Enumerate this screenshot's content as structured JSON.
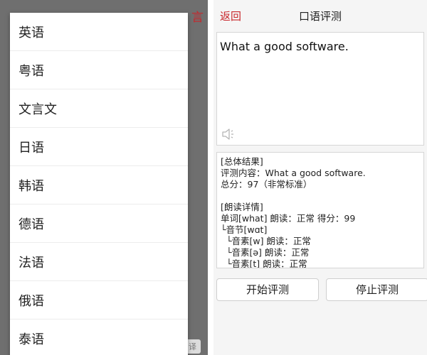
{
  "left": {
    "bg_title_fragment": "言",
    "bg_bottom_fragment": "译",
    "languages": [
      {
        "label": "英语"
      },
      {
        "label": "粤语"
      },
      {
        "label": "文言文"
      },
      {
        "label": "日语"
      },
      {
        "label": "韩语"
      },
      {
        "label": "德语"
      },
      {
        "label": "法语"
      },
      {
        "label": "俄语"
      },
      {
        "label": "泰语"
      }
    ]
  },
  "right": {
    "header": {
      "back_label": "返回",
      "title": "口语评测"
    },
    "input": {
      "text": "What a good software.",
      "speaker_icon": "speaker-icon"
    },
    "result": {
      "lines": [
        "[总体结果]",
        "评测内容：What a good software.",
        "总分：97（非常标准）",
        "",
        "[朗读详情]",
        "单词[what] 朗读：正常 得分：99",
        "└音节[wɑt]",
        "  └音素[w] 朗读：正常",
        "  └音素[ə] 朗读：正常",
        "  └音素[t] 朗读：正常"
      ]
    },
    "buttons": {
      "start_label": "开始评测",
      "stop_label": "停止评测"
    }
  },
  "colors": {
    "accent_red": "#c8262b",
    "dim_overlay": "#6f6f6f"
  }
}
